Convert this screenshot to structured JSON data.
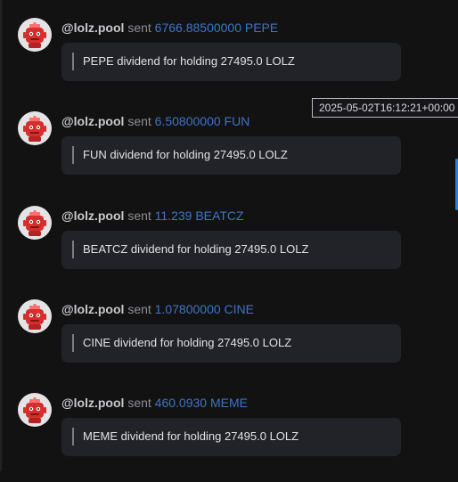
{
  "messages": [
    {
      "user": "@lolz.pool",
      "verb": "sent",
      "amount": "6766.88500000 PEPE",
      "text": "PEPE dividend for holding 27495.0 LOLZ"
    },
    {
      "user": "@lolz.pool",
      "verb": "sent",
      "amount": "6.50800000 FUN",
      "text": "FUN dividend for holding 27495.0 LOLZ"
    },
    {
      "user": "@lolz.pool",
      "verb": "sent",
      "amount": "11.239 BEATCZ",
      "text": "BEATCZ dividend for holding 27495.0 LOLZ"
    },
    {
      "user": "@lolz.pool",
      "verb": "sent",
      "amount": "1.07800000 CINE",
      "text": "CINE dividend for holding 27495.0 LOLZ"
    },
    {
      "user": "@lolz.pool",
      "verb": "sent",
      "amount": "460.0930 MEME",
      "text": "MEME dividend for holding 27495.0 LOLZ"
    }
  ],
  "tooltip": {
    "timestamp": "2025-05-02T16:12:21+00:00"
  },
  "colors": {
    "background": "#131213",
    "bubble": "#212328",
    "amount": "#3d74c4",
    "avatar_robot": "#d62d2d"
  },
  "icons": {
    "avatar": "robot-avatar-icon"
  }
}
